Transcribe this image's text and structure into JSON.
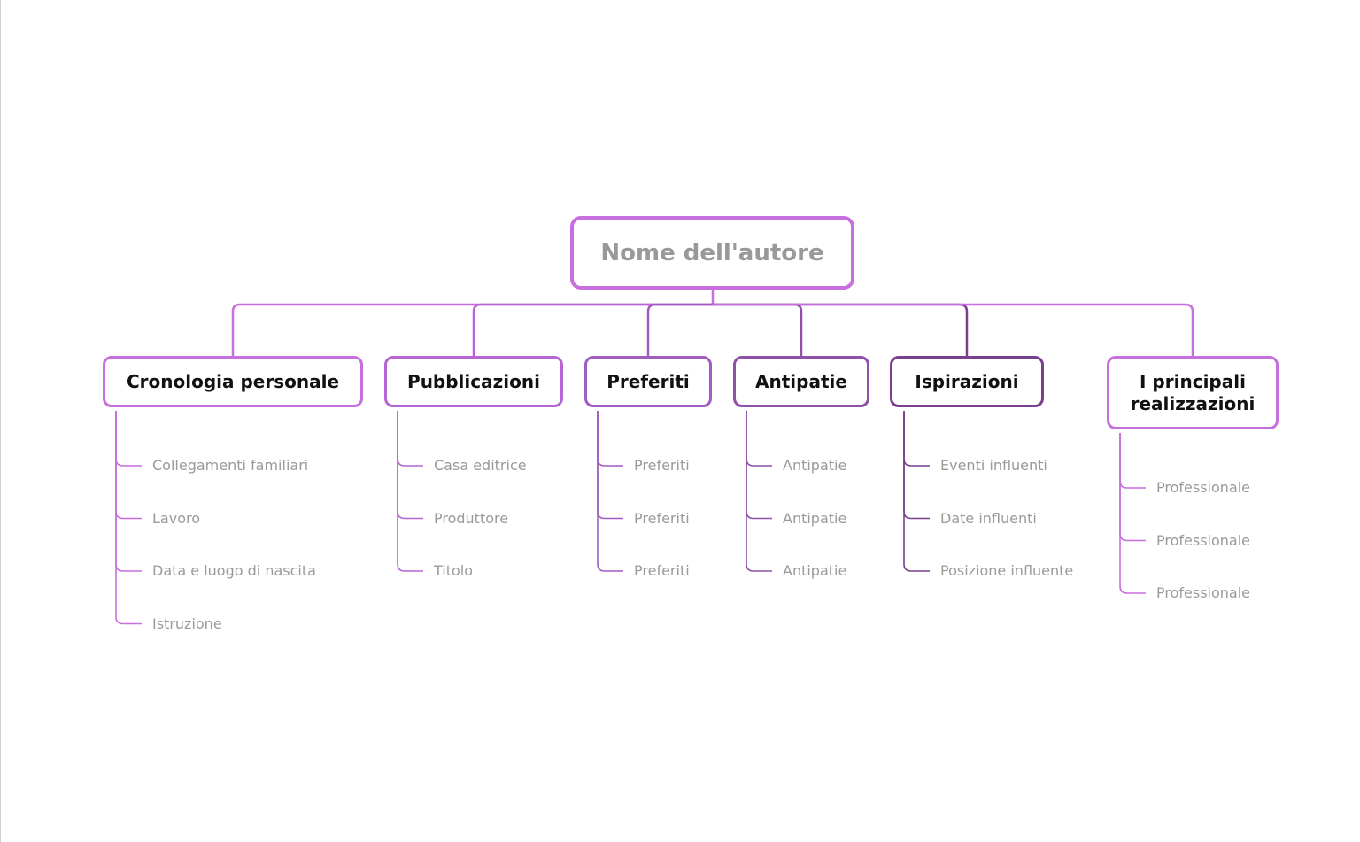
{
  "root": {
    "label": "Nome dell'autore",
    "color": "#C86FE0"
  },
  "branches": [
    {
      "label": "Cronologia personale",
      "color": "#C86FE0",
      "children": [
        "Collegamenti familiari",
        "Lavoro",
        "Data e luogo di nascita",
        "Istruzione"
      ]
    },
    {
      "label": "Pubblicazioni",
      "color": "#B566D4",
      "children": [
        "Casa editrice",
        "Produttore",
        "Titolo"
      ]
    },
    {
      "label": "Preferiti",
      "color": "#A05CC0",
      "children": [
        "Preferiti",
        "Preferiti",
        "Preferiti"
      ]
    },
    {
      "label": "Antipatie",
      "color": "#8E50A8",
      "children": [
        "Antipatie",
        "Antipatie",
        "Antipatie"
      ]
    },
    {
      "label": "Ispirazioni",
      "color": "#7A3F8E",
      "children": [
        "Eventi influenti",
        "Date influenti",
        "Posizione influente"
      ]
    },
    {
      "label": "I principali realizzazioni",
      "color": "#C86FE0",
      "children": [
        "Professionale",
        "Professionale",
        "Professionale"
      ]
    }
  ]
}
